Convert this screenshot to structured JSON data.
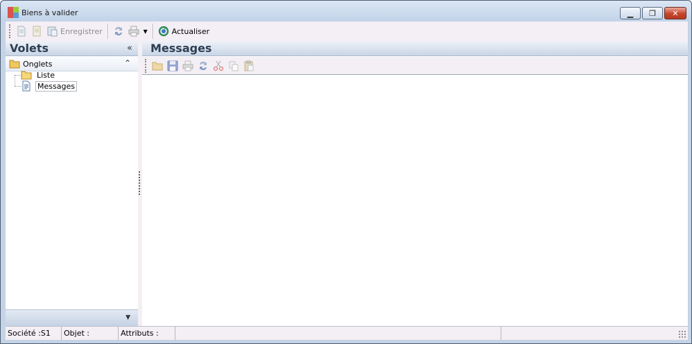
{
  "window": {
    "title": "Biens à valider",
    "minimize_glyph": "▁",
    "maximize_glyph": "❐",
    "close_glyph": "✕"
  },
  "toolbar": {
    "save_label": "Enregistrer",
    "dropdown_glyph": "▾",
    "refresh_label": "Actualiser"
  },
  "left_pane": {
    "title": "Volets",
    "collapse_glyph": "«",
    "group": {
      "title": "Onglets",
      "chevron": "⌃"
    },
    "tree": [
      {
        "label": "Liste",
        "icon": "folder-icon"
      },
      {
        "label": "Messages",
        "icon": "document-icon",
        "selected": true
      }
    ],
    "footer_glyph": "▼"
  },
  "right_pane": {
    "title": "Messages"
  },
  "statusbar": {
    "societe": "Société :S1",
    "objet": "Objet :",
    "attributs": "Attributs :"
  },
  "colors": {
    "pane_header_text": "#2e3e52",
    "close_button": "#c7442a",
    "refresh_ring": "#2e8b57"
  }
}
